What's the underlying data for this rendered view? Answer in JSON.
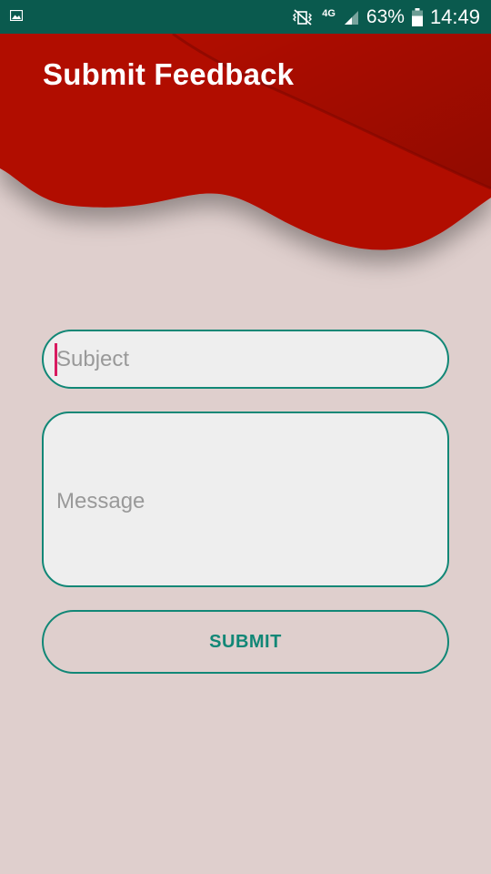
{
  "status_bar": {
    "battery_percent": "63%",
    "time": "14:49",
    "network": "4G",
    "icons": [
      "image-notification-icon",
      "vibrate-mute-icon",
      "4g-icon",
      "signal-icon",
      "battery-icon"
    ]
  },
  "header": {
    "title": "Submit Feedback",
    "color": "#b10f00"
  },
  "form": {
    "subject_placeholder": "Subject",
    "message_placeholder": "Message",
    "submit_label": "SUBMIT",
    "accent_color": "#118776"
  }
}
